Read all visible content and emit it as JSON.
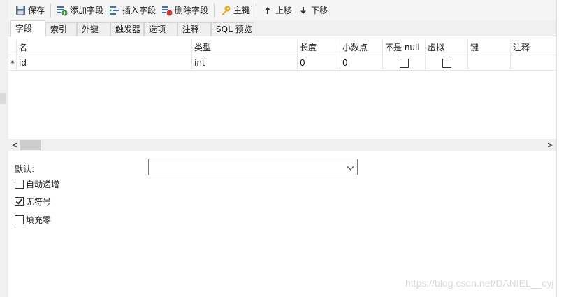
{
  "toolbar": {
    "buttons": [
      {
        "label": "保存",
        "icon": "save-icon"
      },
      {
        "label": "添加字段",
        "icon": "add-field-icon"
      },
      {
        "label": "插入字段",
        "icon": "insert-field-icon"
      },
      {
        "label": "删除字段",
        "icon": "delete-field-icon"
      },
      {
        "label": "主键",
        "icon": "key-icon"
      },
      {
        "label": "上移",
        "icon": "arrow-up-icon"
      },
      {
        "label": "下移",
        "icon": "arrow-down-icon"
      }
    ]
  },
  "tabs": [
    "字段",
    "索引",
    "外键",
    "触发器",
    "选项",
    "注释",
    "SQL 预览"
  ],
  "grid": {
    "columns": [
      "名",
      "类型",
      "长度",
      "小数点",
      "不是 null",
      "虚拟",
      "键",
      "注释"
    ],
    "rows": [
      {
        "marker": "*",
        "name": "id",
        "type": "int",
        "length": "0",
        "decimals": "0",
        "not_null": false,
        "virtual": false,
        "key": "",
        "comment": ""
      }
    ]
  },
  "properties": {
    "default_label": "默认:",
    "default_value": "",
    "auto_increment": {
      "label": "自动递增",
      "checked": false
    },
    "unsigned": {
      "label": "无符号",
      "checked": true
    },
    "zerofill": {
      "label": "填充零",
      "checked": false
    }
  },
  "watermark": "https://blog.csdn.net/DANIEL__cyj",
  "colors": {
    "accent_green": "#3a9a3a",
    "accent_red": "#d9342b",
    "key_gold": "#e0a81c",
    "field_blue": "#3c6fb4"
  }
}
